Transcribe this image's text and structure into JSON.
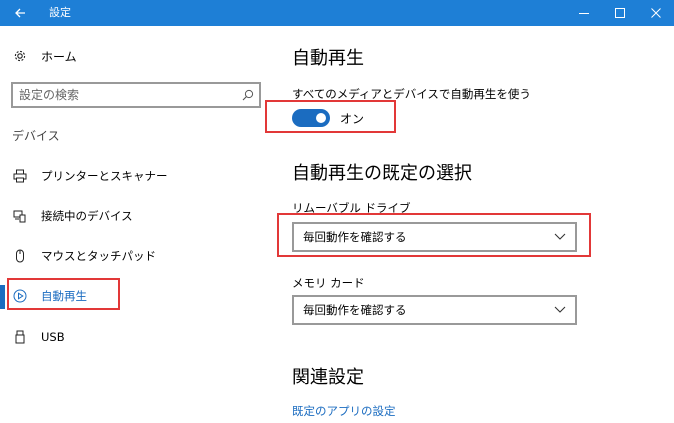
{
  "window": {
    "title": "設定",
    "titlebar_color": "#1e7fd6",
    "accent_color": "#1b6cc0",
    "highlight_color": "#e23838",
    "icons": {
      "back": "back-arrow-icon",
      "minimize": "minimize-icon",
      "maximize": "maximize-icon",
      "close": "close-icon"
    }
  },
  "sidebar": {
    "home": {
      "label": "ホーム",
      "icon": "gear-icon"
    },
    "search": {
      "placeholder": "設定の検索",
      "icon": "search-icon"
    },
    "section_label": "デバイス",
    "items": [
      {
        "label": "プリンターとスキャナー",
        "icon": "printer-icon",
        "active": false
      },
      {
        "label": "接続中のデバイス",
        "icon": "connected-devices-icon",
        "active": false
      },
      {
        "label": "マウスとタッチパッド",
        "icon": "mouse-icon",
        "active": false
      },
      {
        "label": "自動再生",
        "icon": "autoplay-icon",
        "active": true
      },
      {
        "label": "USB",
        "icon": "usb-icon",
        "active": false
      }
    ]
  },
  "main": {
    "autoplay": {
      "heading": "自動再生",
      "toggle_label": "すべてのメディアとデバイスで自動再生を使う",
      "toggle_state": "オン",
      "toggle_on": true
    },
    "defaults": {
      "heading": "自動再生の既定の選択",
      "removable_drive": {
        "label": "リムーバブル ドライブ",
        "value": "毎回動作を確認する"
      },
      "memory_card": {
        "label": "メモリ カード",
        "value": "毎回動作を確認する"
      }
    },
    "related": {
      "heading": "関連設定",
      "link": "既定のアプリの設定"
    }
  }
}
